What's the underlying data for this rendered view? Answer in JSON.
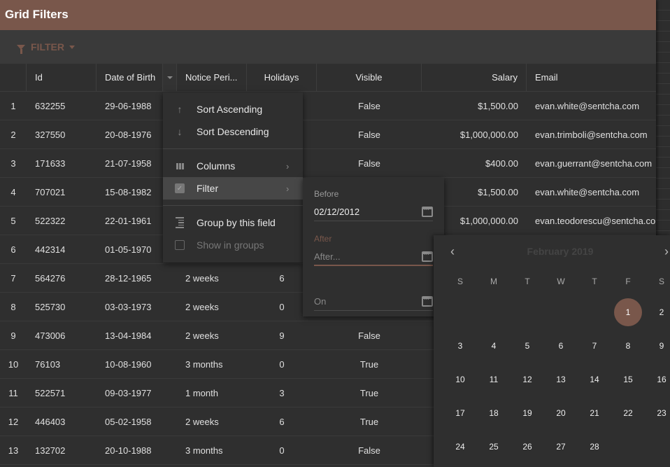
{
  "app": {
    "title": "Grid Filters"
  },
  "toolbar": {
    "filter_label": "FILTER"
  },
  "colors": {
    "accent": "#79574b",
    "background": "#2f2f2f"
  },
  "grid": {
    "columns": [
      "",
      "Id",
      "Date of Birth",
      "Notice Peri...",
      "Holidays",
      "Visible",
      "Salary",
      "Email"
    ],
    "rows": [
      [
        "1",
        "632255",
        "29-06-1988",
        "",
        "",
        "False",
        "$1,500.00",
        "evan.white@sentcha.com"
      ],
      [
        "2",
        "327550",
        "20-08-1976",
        "",
        "",
        "False",
        "$1,000,000.00",
        "evan.trimboli@sentcha.com"
      ],
      [
        "3",
        "171633",
        "21-07-1958",
        "",
        "",
        "False",
        "$400.00",
        "evan.guerrant@sentcha.com"
      ],
      [
        "4",
        "707021",
        "15-08-1982",
        "",
        "",
        "",
        "$1,500.00",
        "evan.white@sentcha.com"
      ],
      [
        "5",
        "522322",
        "22-01-1961",
        "",
        "",
        "",
        "$1,000,000.00",
        "evan.teodorescu@sentcha.com"
      ],
      [
        "6",
        "442314",
        "01-05-1970",
        "",
        "",
        "",
        "",
        ""
      ],
      [
        "7",
        "564276",
        "28-12-1965",
        "2 weeks",
        "6",
        "",
        "",
        ""
      ],
      [
        "8",
        "525730",
        "03-03-1973",
        "2 weeks",
        "0",
        "",
        "",
        ""
      ],
      [
        "9",
        "473006",
        "13-04-1984",
        "2 weeks",
        "9",
        "False",
        "",
        ""
      ],
      [
        "10",
        "76103",
        "10-08-1960",
        "3 months",
        "0",
        "True",
        "",
        ""
      ],
      [
        "11",
        "522571",
        "09-03-1977",
        "1 month",
        "3",
        "True",
        "",
        ""
      ],
      [
        "12",
        "446403",
        "05-02-1958",
        "2 weeks",
        "6",
        "True",
        "",
        ""
      ],
      [
        "13",
        "132702",
        "20-10-1988",
        "3 months",
        "0",
        "False",
        "",
        ""
      ]
    ]
  },
  "column_menu": {
    "items": [
      {
        "label": "Sort Ascending",
        "icon": "arrow-up-icon"
      },
      {
        "label": "Sort Descending",
        "icon": "arrow-down-icon"
      },
      {
        "label": "Columns",
        "icon": "columns-icon",
        "submenu": true
      },
      {
        "label": "Filter",
        "icon": "checkbox-checked-icon",
        "submenu": true,
        "active": true
      },
      {
        "label": "Group by this field",
        "icon": "group-icon"
      },
      {
        "label": "Show in groups",
        "icon": "checkbox-empty-icon",
        "disabled": true
      }
    ]
  },
  "filter_menu": {
    "before_label": "Before",
    "before_value": "02/12/2012",
    "after_label": "After",
    "after_placeholder": "After...",
    "on_placeholder": "On"
  },
  "datepicker": {
    "title": "February 2019",
    "prev": "‹",
    "next": "›",
    "weekdays": [
      "S",
      "M",
      "T",
      "W",
      "T",
      "F",
      "S"
    ],
    "leading_blanks": 5,
    "days": [
      "1",
      "2",
      "3",
      "4",
      "5",
      "6",
      "7",
      "8",
      "9",
      "10",
      "11",
      "12",
      "13",
      "14",
      "15",
      "16",
      "17",
      "18",
      "19",
      "20",
      "21",
      "22",
      "23",
      "24",
      "25",
      "26",
      "27",
      "28"
    ],
    "selected": "1"
  }
}
